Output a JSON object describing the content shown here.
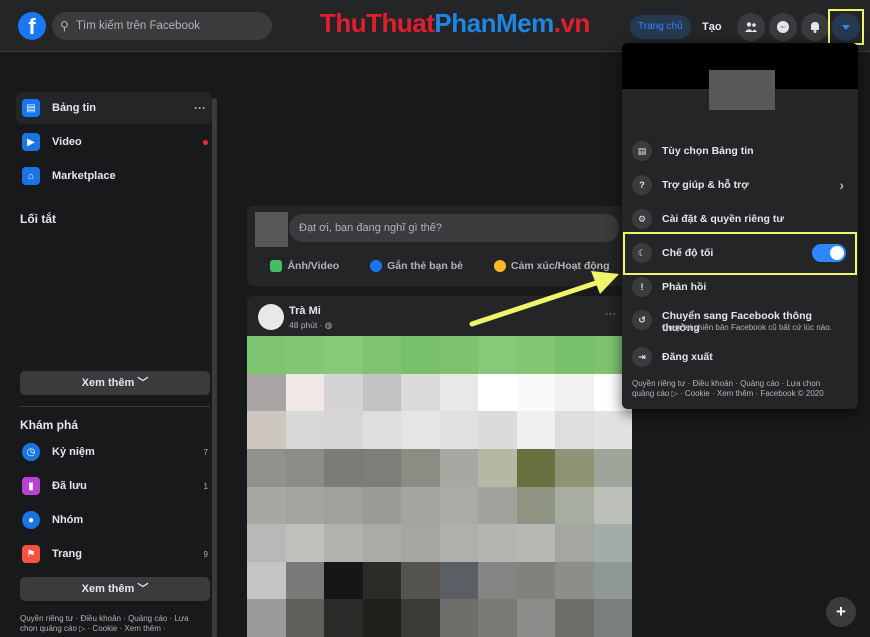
{
  "header": {
    "logo": "f",
    "search_placeholder": "Tìm kiếm trên Facebook",
    "watermark": {
      "part1": "Thu",
      "part2": "Thuat",
      "part3": "PhanMem",
      "part4": ".vn"
    },
    "home_label": "Trang chủ",
    "create_label": "Tạo",
    "icons": [
      "friends-icon",
      "messenger-icon",
      "notifications-icon",
      "account-menu-arrow-icon"
    ]
  },
  "sidebar": {
    "items": [
      {
        "label": "Bảng tin",
        "icon": "news-feed-icon",
        "more": "···"
      },
      {
        "label": "Video",
        "icon": "video-icon"
      },
      {
        "label": "Marketplace",
        "icon": "marketplace-icon"
      }
    ],
    "shortcuts_heading": "Lối tắt",
    "see_more_1": "Xem thêm ",
    "explore_heading": "Khám phá",
    "explore_items": [
      {
        "label": "Kỷ niệm",
        "count": "7",
        "icon": "memories-icon"
      },
      {
        "label": "Đã lưu",
        "count": "1",
        "icon": "saved-icon"
      },
      {
        "label": "Nhóm",
        "count": "",
        "icon": "groups-icon"
      },
      {
        "label": "Trang",
        "count": "9",
        "icon": "pages-icon"
      }
    ],
    "see_more_2": "Xem thêm ",
    "footer_line1": "Quyền riêng tư · Điều khoản · Quảng cáo · Lựa",
    "footer_line2": "chọn quảng cáo ▷ · Cookie · Xem thêm ·"
  },
  "composer": {
    "placeholder": "Đạt ơi, bạn đang nghĩ gì thế?",
    "actions": [
      {
        "label": "Ảnh/Video",
        "color": "#45bd62"
      },
      {
        "label": "Gắn thẻ bạn bè",
        "color": "#1877f2"
      },
      {
        "label": "Cảm xúc/Hoạt động",
        "color": "#f7b928"
      }
    ]
  },
  "post": {
    "author": "Trà Mi",
    "time": "48 phút · ",
    "more": "···",
    "mosaic_colors": [
      "#7fc46e",
      "#83c774",
      "#86c979",
      "#7fc46e",
      "#78c16a",
      "#7cc26f",
      "#86c979",
      "#82c673",
      "#79c16b",
      "#7ec36f",
      "#a8a4a3",
      "#f1e7e6",
      "#d4d3d5",
      "#c3c2c4",
      "#dcdbdc",
      "#e8e8e8",
      "#ffffff",
      "#fafafa",
      "#f3f2f2",
      "#ffffff",
      "#cdc6c1",
      "#d8d8d8",
      "#d6d6d6",
      "#dedede",
      "#e5e5e5",
      "#e1e1e1",
      "#dbdbdb",
      "#f0f0f0",
      "#dedede",
      "#e2e2e2",
      "#90928c",
      "#8a8d86",
      "#7a7c76",
      "#7c7e77",
      "#8b8c84",
      "#a6a8a1",
      "#b5b9a3",
      "#6b7041",
      "#8f9476",
      "#a0a59a",
      "#a6a8a3",
      "#a2a49f",
      "#9fa19c",
      "#9a9c96",
      "#a2a49d",
      "#a9aba5",
      "#9fa39c",
      "#8f9482",
      "#a8ada1",
      "#bbbfb7",
      "#b8b9b6",
      "#c0c1bd",
      "#b0b2ad",
      "#a9aba6",
      "#a4a6a1",
      "#aeb0ab",
      "#b3b5b0",
      "#b7b8b4",
      "#a3a6a1",
      "#a4aca9",
      "#c5c6c3",
      "#7a7b78",
      "#151716",
      "#2c2b26",
      "#54534d",
      "#5c5e66",
      "#858482",
      "#80837d",
      "#8c8e89",
      "#8f9893",
      "#9b9c99",
      "#5f605c",
      "#2b2c2a",
      "#1f1f1c",
      "#3b3b37",
      "#6e6f6b",
      "#7a7b77",
      "#8c8d8a",
      "#6c6d69",
      "#7a807d"
    ]
  },
  "menu": {
    "items": [
      {
        "label": "Tùy chọn Bảng tin",
        "icon": "news-feed-preferences-icon",
        "glyph": "▤"
      },
      {
        "label": "Trợ giúp & hỗ trợ",
        "icon": "help-icon",
        "glyph": "?",
        "chevron": "›"
      },
      {
        "label": "Cài đặt & quyền riêng tư",
        "icon": "settings-icon",
        "glyph": "⚙"
      },
      {
        "label": "Chế độ tối",
        "icon": "dark-mode-moon-icon",
        "glyph": "☾",
        "toggle": true
      },
      {
        "label": "Phản hồi",
        "icon": "feedback-icon",
        "glyph": "!"
      },
      {
        "label": "Chuyển sang Facebook thông thường",
        "sub": "Quay lại phiên bản Facebook cũ bất cứ lúc nào.",
        "icon": "switch-classic-icon",
        "glyph": "↺"
      },
      {
        "label": "Đăng xuất",
        "icon": "logout-icon",
        "glyph": "⇥"
      }
    ],
    "footer_line1": "Quyền riêng tư · Điều khoản · Quảng cáo · Lựa chọn",
    "footer_line2": "quảng cáo ▷ · Cookie · Xem thêm · Facebook © 2020"
  },
  "colors": {
    "accent": "#2d88ff",
    "highlight": "#f1f56a",
    "background": "#18191a",
    "surface": "#242526"
  }
}
